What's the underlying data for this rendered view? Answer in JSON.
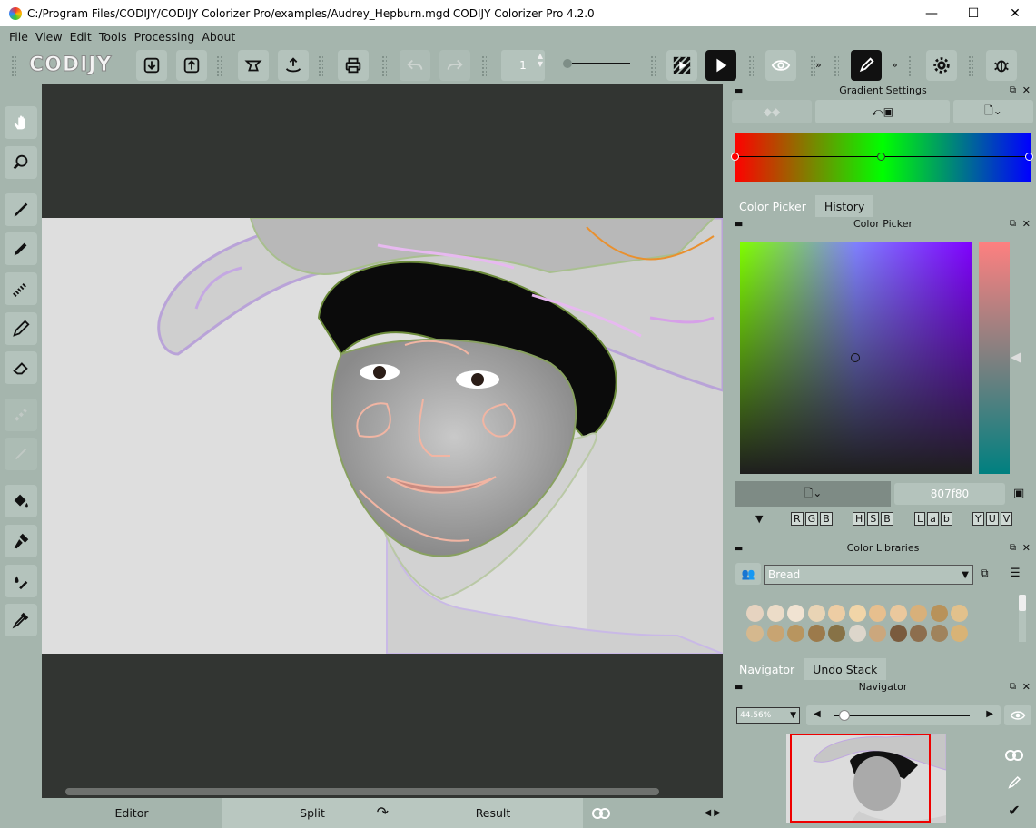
{
  "window": {
    "title": "C:/Program Files/CODIJY/CODIJY Colorizer Pro/examples/Audrey_Hepburn.mgd CODIJY Colorizer Pro 4.2.0",
    "min": "—",
    "max": "☐",
    "close": "✕"
  },
  "menu": [
    "File",
    "View",
    "Edit",
    "Tools",
    "Processing",
    "About"
  ],
  "toolbar": {
    "logo": "CODIJY",
    "frame_number": "1"
  },
  "bottom_tabs": {
    "editor": "Editor",
    "split": "Split",
    "result": "Result"
  },
  "gradient": {
    "title": "Gradient Settings",
    "colors": [
      "#ff0000",
      "#00ff00",
      "#0000ff"
    ]
  },
  "color_panel": {
    "tabs": [
      "Color Picker",
      "History"
    ],
    "title": "Color Picker",
    "hex_value": "807f80",
    "modes": [
      "R",
      "G",
      "B",
      "H",
      "S",
      "B",
      "L",
      "a",
      "b",
      "Y",
      "U",
      "V"
    ]
  },
  "libraries": {
    "title": "Color Libraries",
    "selected": "Bread",
    "swatches": [
      [
        "#e6d3c0",
        "#ecdcc8",
        "#f1e3d2",
        "#e9d4b5",
        "#edcda4",
        "#f1d5a8",
        "#e7bf8e",
        "#eac89d",
        "#d8b07a",
        "#b8925a",
        "#e2c18c"
      ],
      [
        "#d5b88e",
        "#c8a472",
        "#b8955f",
        "#9c7a4b",
        "#877246",
        "#ddd6cb",
        "#cba77d",
        "#7a5b3e",
        "#8d6e4e",
        "#a0835c",
        "#d8b376"
      ]
    ]
  },
  "navigator": {
    "tabs": [
      "Navigator",
      "Undo Stack"
    ],
    "title": "Navigator",
    "zoom": "44.56%"
  }
}
